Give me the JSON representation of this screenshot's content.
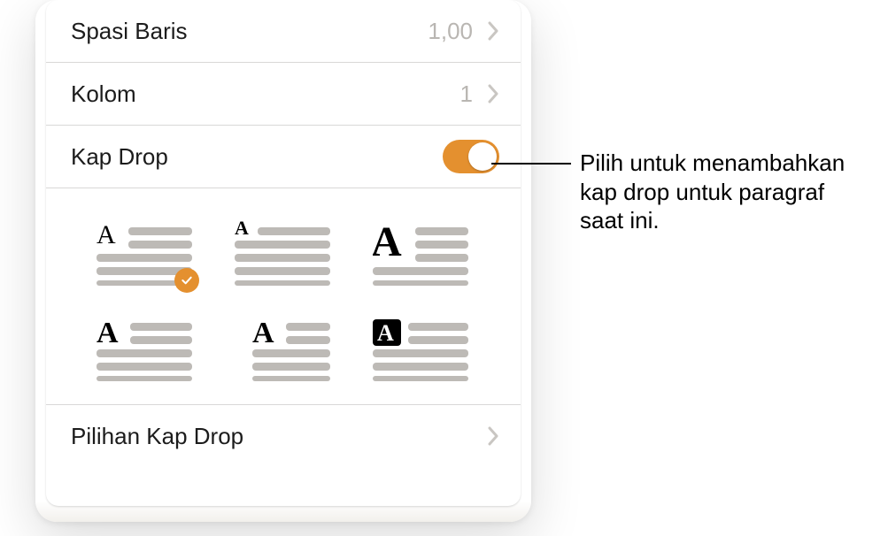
{
  "accent_color": "#e4902f",
  "rows": {
    "line_spacing": {
      "label": "Spasi Baris",
      "value": "1,00"
    },
    "columns": {
      "label": "Kolom",
      "value": "1"
    },
    "drop_cap": {
      "label": "Kap Drop",
      "on": true
    },
    "options": {
      "label": "Pilihan Kap Drop"
    }
  },
  "styles_selected_index": 0,
  "callout": {
    "line1": "Pilih untuk menambahkan",
    "line2": "kap drop untuk paragraf",
    "line3": "saat ini."
  },
  "chart_data": null
}
